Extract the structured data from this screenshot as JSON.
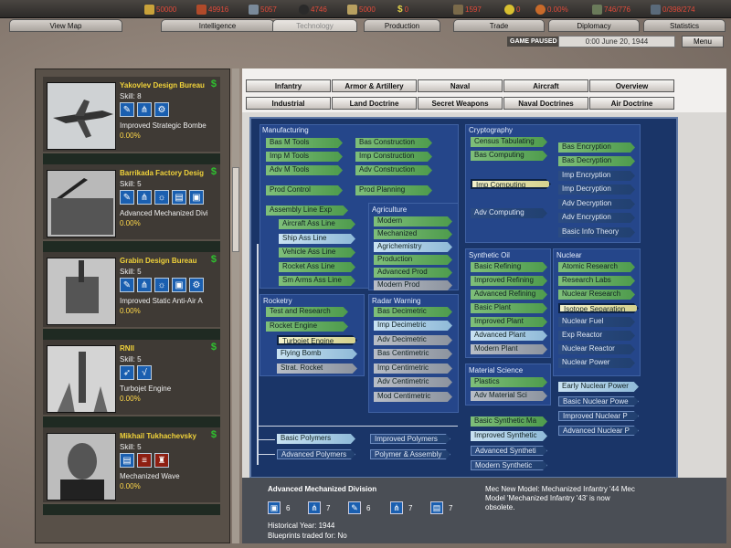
{
  "resources": [
    {
      "id": "manpower",
      "value": "50000",
      "color": "#e24a3a",
      "icon": "manpower-icon"
    },
    {
      "id": "energy",
      "value": "49916",
      "color": "#e24a3a",
      "icon": "energy-icon"
    },
    {
      "id": "metal",
      "value": "5057",
      "color": "#e24a3a",
      "icon": "metal-icon"
    },
    {
      "id": "oil",
      "value": "4746",
      "color": "#e24a3a",
      "icon": "oil-icon"
    },
    {
      "id": "rare",
      "value": "5000",
      "color": "#e24a3a",
      "icon": "rare-materials-icon"
    },
    {
      "id": "money",
      "value": "0",
      "color": "#e24a3a",
      "icon": "money-icon"
    },
    {
      "id": "supplies",
      "value": "1597",
      "color": "#e24a3a",
      "icon": "supplies-icon"
    },
    {
      "id": "nuclear",
      "value": "0",
      "color": "#e24a3a",
      "icon": "nuclear-icon"
    },
    {
      "id": "dissent",
      "value": "0.00%",
      "color": "#e24a3a",
      "icon": "dissent-icon"
    },
    {
      "id": "transport",
      "value": "746/776",
      "color": "#e24a3a",
      "icon": "transport-icon"
    },
    {
      "id": "escorts",
      "value": "0/398/274",
      "color": "#e24a3a",
      "icon": "escorts-icon"
    }
  ],
  "tabs": [
    "View Map",
    "Intelligence",
    "Technology",
    "Production",
    "Trade",
    "Diplomacy",
    "Statistics"
  ],
  "status": {
    "game_paused": "GAME PAUSED",
    "date": "0:00 June 20, 1944",
    "menu": "Menu"
  },
  "teams": [
    {
      "name": "Yakovlev Design Bureau",
      "skill": "Skill: 8",
      "project": "Improved Strategic Bombe",
      "pct": "0.00%",
      "icons": [
        "wrench",
        "rotor",
        "gear"
      ]
    },
    {
      "name": "Barrikada Factory Desig",
      "skill": "Skill: 5",
      "project": "Advanced Mechanized Divi",
      "pct": "0.00%",
      "icons": [
        "wrench",
        "rotor",
        "bulb",
        "book",
        "engine"
      ]
    },
    {
      "name": "Grabin Design Bureau",
      "skill": "Skill: 5",
      "project": "Improved Static Anti-Air A",
      "pct": "0.00%",
      "icons": [
        "wrench",
        "rotor",
        "bulb",
        "engine",
        "gear"
      ]
    },
    {
      "name": "RNII",
      "skill": "Skill: 5",
      "project": "Turbojet Engine",
      "pct": "0.00%",
      "icons": [
        "rocket",
        "formula"
      ]
    },
    {
      "name": "Mikhail Tukhachevsky",
      "skill": "Skill: 5",
      "project": "Mechanized Wave",
      "pct": "0.00%",
      "icons": [
        "book",
        "doctrine",
        "artillery"
      ]
    }
  ],
  "categories_row1": [
    "Infantry",
    "Armor & Artillery",
    "Naval",
    "Aircraft",
    "Overview"
  ],
  "categories_row2": [
    "Industrial",
    "Land Doctrine",
    "Secret Weapons",
    "Naval Doctrines",
    "Air Doctrine"
  ],
  "groups": {
    "manufacturing": "Manufacturing",
    "agriculture": "Agriculture",
    "rocketry": "Rocketry",
    "radar": "Radar Warning",
    "cryptography": "Cryptography",
    "synthetic": "Synthetic Oil",
    "nuclear": "Nuclear",
    "materials": "Material Science"
  },
  "nodes": {
    "bas_m_tools": "Bas M Tools",
    "imp_m_tools": "Imp M Tools",
    "adv_m_tools": "Adv M Tools",
    "bas_construction": "Bas Construction",
    "imp_construction": "Imp Construction",
    "adv_construction": "Adv Construction",
    "prod_control": "Prod Control",
    "prod_planning": "Prod Planning",
    "assembly_line": "Assembly Line Exp",
    "aircraft_ass": "Aircraft Ass Line",
    "ship_ass": "Ship Ass Line",
    "vehicle_ass": "Vehicle Ass Line",
    "rocket_ass": "Rocket Ass Line",
    "smarms_ass": "Sm Arms Ass Line",
    "modern": "Modern",
    "mechanized": "Mechanized",
    "agrichemistry": "Agrichemistry",
    "production": "Production",
    "advanced_prod": "Advanced Prod",
    "modern_prod": "Modern Prod",
    "test_research": "Test and Research",
    "rocket_engine": "Rocket Engine",
    "turbojet": "Turbojet Engine",
    "flying_bomb": "Flying Bomb",
    "strat_rocket": "Strat. Rocket",
    "bas_decimetric": "Bas Decimetric",
    "imp_decimetric": "Imp Decimetric",
    "adv_decimetric": "Adv Decimetric",
    "bas_centimetric": "Bas Centimetric",
    "imp_centimetric": "Imp Centimetric",
    "adv_centimetric": "Adv Centimetric",
    "mod_centimetric": "Mod Centimetric",
    "census": "Census Tabulating",
    "bas_computing": "Bas Computing",
    "imp_computing": "Imp Computing",
    "adv_computing": "Adv Computing",
    "bas_encryption": "Bas Encryption",
    "bas_decryption": "Bas Decryption",
    "imp_encryption": "Imp Encryption",
    "imp_decryption": "Imp Decryption",
    "adv_decryption": "Adv Decryption",
    "adv_encryption": "Adv Encryption",
    "basic_info": "Basic Info Theory",
    "basic_refining": "Basic Refining",
    "improved_refining": "Improved Refining",
    "advanced_refining": "Advanced Refining",
    "basic_plant": "Basic Plant",
    "improved_plant": "Improved Plant",
    "advanced_plant": "Advanced Plant",
    "modern_plant": "Modern Plant",
    "atomic_research": "Atomic Research",
    "research_labs": "Research Labs",
    "nuclear_research": "Nuclear Research",
    "isotope": "Isotope Separation",
    "nuclear_fuel": "Nuclear Fuel",
    "exp_reactor": "Exp Reactor",
    "nuclear_reactor": "Nuclear Reactor",
    "nuclear_power": "Nuclear Power",
    "plastics": "Plastics",
    "adv_material": "Adv Material Sci",
    "early_nuclear_power": "Early Nuclear Power",
    "basic_nuclear_power": "Basic Nuclear Powe",
    "improved_nuclear_p": "Improved Nuclear P",
    "advanced_nuclear_p": "Advanced Nuclear P",
    "basic_synthetic": "Basic Synthetic Ma",
    "improved_synthetic": "Improved Synthetic",
    "advanced_synthetic": "Advanced Syntheti",
    "modern_synthetic": "Modern Synthetic",
    "basic_polymers": "Basic Polymers",
    "improved_polymers": "Improved Polymers",
    "advanced_polymers": "Advanced Polymers",
    "polymer_assembly": "Polymer & Assembly"
  },
  "info": {
    "title": "Advanced Mechanized Division",
    "requirements": [
      "6",
      "7",
      "6",
      "7",
      "7"
    ],
    "year": "Historical Year: 1944",
    "blueprints": "Blueprints traded for: No",
    "text": "Mec New Model: Mechanized Infantry '44 Mec Model 'Mechanized Infantry '43' is now obsolete."
  }
}
